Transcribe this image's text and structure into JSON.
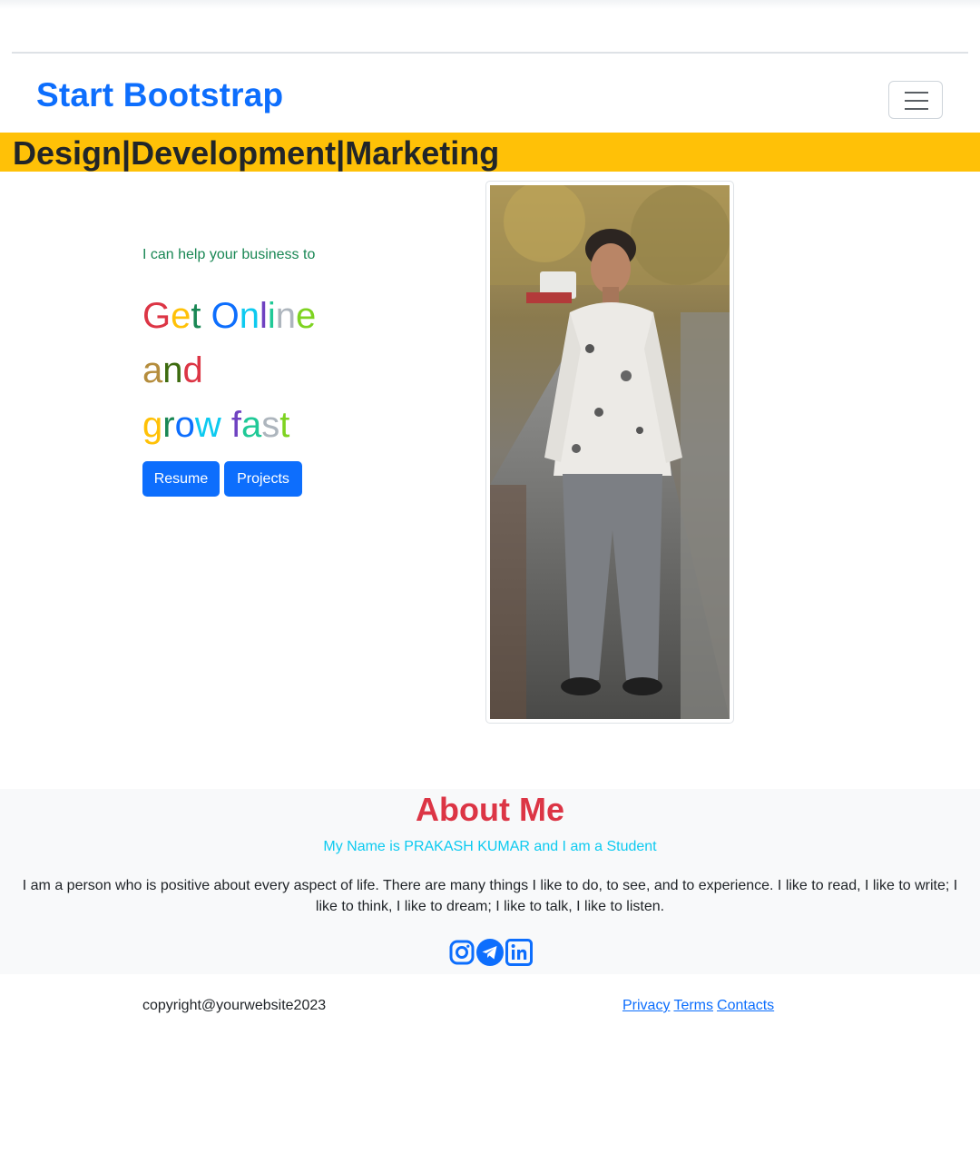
{
  "navbar": {
    "brand": "Start Bootstrap",
    "toggler_icon": "hamburger-menu-icon"
  },
  "ribbon": {
    "text": "Design|Development|Marketing"
  },
  "hero": {
    "tagline": "I can help your business to",
    "headline_lines": [
      "Get Online",
      "and",
      "grow fast"
    ],
    "buttons": {
      "resume": "Resume",
      "projects": "Projects"
    }
  },
  "about": {
    "title": "About Me",
    "subtitle": "My Name is PRAKASH KUMAR and I am a Student",
    "bio": "I am a person who is positive about every aspect of life. There are many things I like to do, to see, and to experience. I like to read, I like to write; I like to think, I like to dream; I like to talk, I like to listen.",
    "social_icons": [
      "instagram-icon",
      "telegram-icon",
      "linkedin-icon"
    ]
  },
  "footer": {
    "copyright": "copyright@yourwebsite2023",
    "links": {
      "privacy": "Privacy",
      "terms": "Terms",
      "contacts": "Contacts"
    }
  },
  "colors": {
    "primary": "#0d6efd",
    "ribbon": "#ffc107",
    "about_title": "#dc3545",
    "about_subtitle": "#0dcaf0",
    "tagline": "#198754"
  }
}
